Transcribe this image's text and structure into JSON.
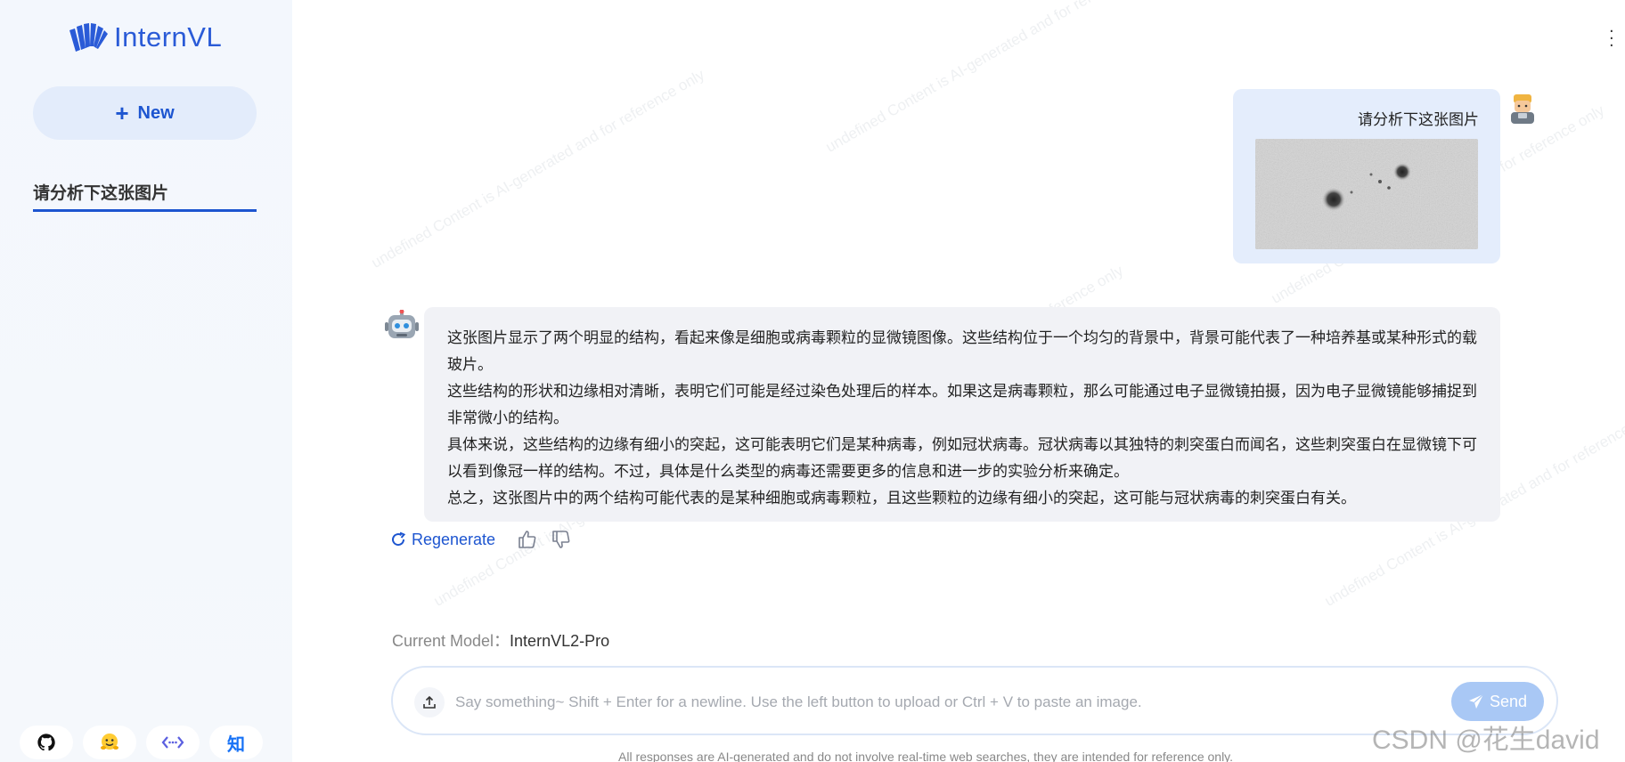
{
  "app": {
    "logo_text": "InternVL",
    "brand_color": "#2a5bd7"
  },
  "sidebar": {
    "new_label": "New",
    "conversations": [
      {
        "title": "请分析下这张图片",
        "active": true
      }
    ],
    "footer_icons": [
      "github-icon",
      "huggingface-icon",
      "code-link-icon",
      "zhihu-icon"
    ],
    "zhihu_glyph": "知"
  },
  "watermark_text": "undefined Content is AI-generated and for reference only",
  "chat": {
    "user_message": "请分析下这张图片",
    "assistant_paragraphs": [
      "这张图片显示了两个明显的结构，看起来像是细胞或病毒颗粒的显微镜图像。这些结构位于一个均匀的背景中，背景可能代表了一种培养基或某种形式的载玻片。",
      "这些结构的形状和边缘相对清晰，表明它们可能是经过染色处理后的样本。如果这是病毒颗粒，那么可能通过电子显微镜拍摄，因为电子显微镜能够捕捉到非常微小的结构。",
      "具体来说，这些结构的边缘有细小的突起，这可能表明它们是某种病毒，例如冠状病毒。冠状病毒以其独特的刺突蛋白而闻名，这些刺突蛋白在显微镜下可以看到像冠一样的结构。不过，具体是什么类型的病毒还需要更多的信息和进一步的实验分析来确定。",
      "总之，这张图片中的两个结构可能代表的是某种细胞或病毒颗粒，且这些颗粒的边缘有细小的突起，这可能与冠状病毒的刺突蛋白有关。"
    ],
    "regenerate_label": "Regenerate"
  },
  "model": {
    "label": "Current Model：",
    "value": "InternVL2-Pro"
  },
  "composer": {
    "placeholder": "Say something~ Shift + Enter for a newline. Use the left button to upload or Ctrl + V to paste an image.",
    "send_label": "Send"
  },
  "disclaimer": "All responses are AI-generated and do not involve real-time web searches, they are intended for reference only.",
  "source_watermark": "CSDN @花生david"
}
